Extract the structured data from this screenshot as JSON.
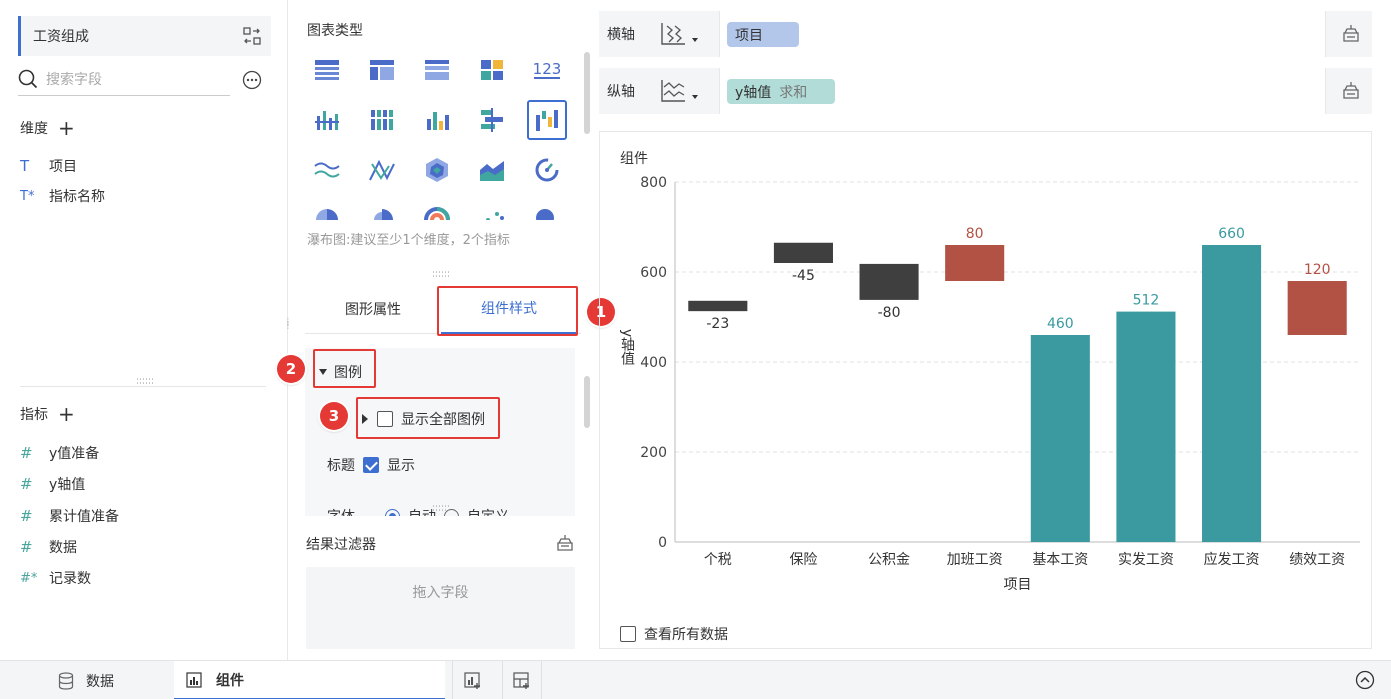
{
  "left": {
    "dataset_name": "工资组成",
    "search_placeholder": "搜索字段",
    "dimension_title": "维度",
    "dimensions": [
      {
        "icon": "text-field-icon",
        "glyph": "T",
        "label": "项目"
      },
      {
        "icon": "derived-text-field-icon",
        "glyph": "T*",
        "label": "指标名称"
      }
    ],
    "measure_title": "指标",
    "measures": [
      {
        "icon": "number-field-icon",
        "glyph": "#",
        "label": "y值准备"
      },
      {
        "icon": "number-field-icon",
        "glyph": "#",
        "label": "y轴值"
      },
      {
        "icon": "number-field-icon",
        "glyph": "#",
        "label": "累计值准备"
      },
      {
        "icon": "number-field-icon",
        "glyph": "#",
        "label": "数据"
      },
      {
        "icon": "derived-number-field-icon",
        "glyph": "#*",
        "label": "记录数"
      }
    ]
  },
  "middle": {
    "chart_type_title": "图表类型",
    "chart_types": [
      "table-icon",
      "cross-table-icon",
      "detail-table-icon",
      "kpi-block-icon",
      "number-icon",
      "grouped-bar-icon",
      "stacked-bar-icon",
      "multi-bar-icon",
      "range-bar-icon",
      "waterfall-icon",
      "line-icon",
      "radar-line-icon",
      "radar-icon",
      "area-icon",
      "gauge-icon",
      "pie-icon",
      "rose-pie-icon",
      "multi-pie-icon",
      "scatter-icon",
      "bubble-icon"
    ],
    "selected_chart_type": "waterfall-icon",
    "hint": "瀑布图:建议至少1个维度，2个指标",
    "tabs": [
      "图形属性",
      "组件样式"
    ],
    "active_tab": "组件样式",
    "legend_section": "图例",
    "show_all_legend": "显示全部图例",
    "title_label": "标题",
    "title_show": "显示",
    "font_label": "字体",
    "font_auto": "自动",
    "font_custom": "自定义",
    "filter_title": "结果过滤器",
    "filter_drop": "拖入字段",
    "badges": [
      "1",
      "2",
      "3"
    ]
  },
  "right": {
    "x_axis_label": "横轴",
    "x_axis_field": "项目",
    "y_axis_label": "纵轴",
    "y_axis_field": "y轴值",
    "y_axis_agg": "求和",
    "card_title": "组件",
    "view_all_data": "查看所有数据"
  },
  "colors": {
    "accent": "#3d6fd0",
    "negative": "#3f3f3f",
    "increase": "#b25244",
    "total": "#3a9aa0",
    "annotation": "#e53935"
  },
  "chart_data": {
    "type": "bar",
    "subtype": "waterfall",
    "categories": [
      "个税",
      "保险",
      "公积金",
      "加班工资",
      "基本工资",
      "实发工资",
      "应发工资",
      "绩效工资"
    ],
    "labels": [
      "-23",
      "-45",
      "-80",
      "80",
      "460",
      "512",
      "660",
      "120"
    ],
    "ranges": [
      [
        513,
        536
      ],
      [
        620,
        665
      ],
      [
        538,
        618
      ],
      [
        580,
        660
      ],
      [
        0,
        460
      ],
      [
        0,
        512
      ],
      [
        0,
        660
      ],
      [
        460,
        580
      ]
    ],
    "kinds": [
      "negative",
      "negative",
      "negative",
      "increase",
      "total",
      "total",
      "total",
      "increase"
    ],
    "xlabel": "项目",
    "ylabel": "y轴值",
    "yticks": [
      0,
      200,
      400,
      600,
      800
    ],
    "ylim": [
      0,
      800
    ],
    "grid": true
  },
  "bottom": {
    "tab_data": "数据",
    "tab_component": "组件"
  }
}
